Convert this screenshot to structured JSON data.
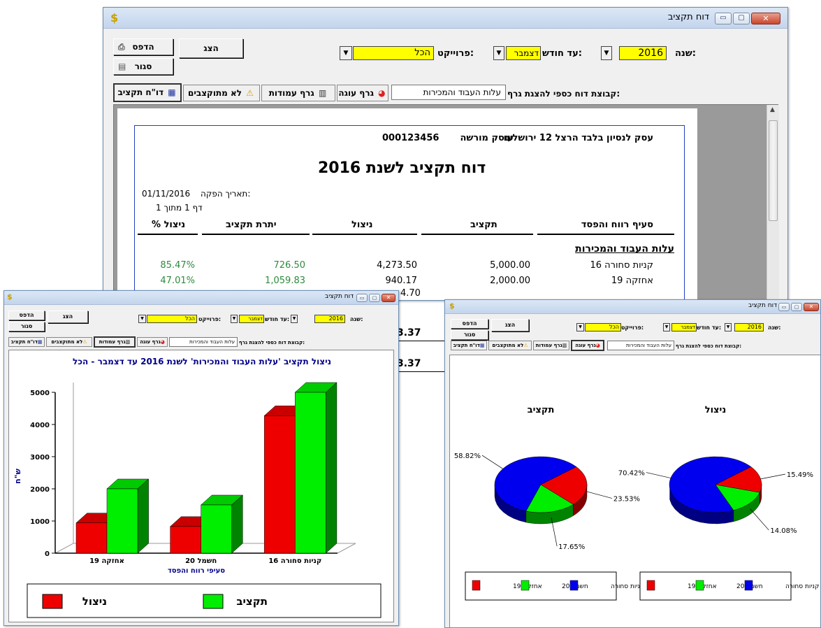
{
  "main_window": {
    "title": "דוח תקציב",
    "app_icon": "$",
    "toolbar": {
      "show_label": "הצג",
      "print_label": "הדפס",
      "close_label": "סגור"
    },
    "filters": {
      "year_label": "שנה:",
      "year_value": "2016",
      "month_label": "עד חודש:",
      "month_value": "דצמבר",
      "project_label": "פרוייקט:",
      "project_value": "הכל"
    },
    "graph_group_label": "קבוצת דוח כספי להצגת גרף:",
    "graph_group_value": "עלות העבוד והמכירות",
    "tabs": [
      {
        "label": "דו\"ח תקציב",
        "icon": "table-icon"
      },
      {
        "label": "לא מתוקצבים",
        "icon": "warning-icon"
      },
      {
        "label": "גרף עמודות",
        "icon": "bar-chart-icon"
      },
      {
        "label": "גרף עוגה",
        "icon": "pie-chart-icon"
      }
    ],
    "report": {
      "business_name": "עסק לנסיון בלבד הרצל 12 ירושלים",
      "business_id_label": "עוסק מורשה",
      "business_id": "000123456",
      "title": "דוח תקציב  לשנת 2016",
      "issue_date_label": "תאריך הפקה:",
      "issue_date": "01/11/2016",
      "page_label": "דף 1 מתוך 1",
      "columns": [
        "סעיף רווח והפסד",
        "תקציב",
        "ניצול",
        "יתרת תקציב",
        "% ניצול"
      ],
      "section_title": "עלות העבוד והמכירות",
      "rows": [
        {
          "item": "קניות סחורה 16",
          "budget": "5,000.00",
          "used": "4,273.50",
          "remaining": "726.50",
          "pct": "85.47%"
        },
        {
          "item": "אחזקה  19",
          "budget": "2,000.00",
          "used": "940.17",
          "remaining": "1,059.83",
          "pct": "47.01%"
        }
      ],
      "partial_values": [
        "4.70",
        "3.37",
        "3.37"
      ]
    }
  },
  "bar_window": {
    "title": "דוח תקציב",
    "toolbar": {
      "show_label": "הצג",
      "print_label": "הדפס",
      "close_label": "סגור"
    },
    "filters": {
      "year_label": "שנה:",
      "year_value": "2016",
      "month_label": "עד חודש:",
      "month_value": "דצמבר",
      "project_label": "פרוייקט:",
      "project_value": "הכל"
    },
    "graph_group_label": "קבוצת דוח כספי להצגת גרף:",
    "graph_group_value": "עלות העבוד והמכירות",
    "tabs": [
      "דו\"ח תקציב",
      "לא מתוקצבים",
      "גרף עמודות",
      "גרף עוגה"
    ]
  },
  "pie_window": {
    "title": "דוח תקציב",
    "toolbar": {
      "show_label": "הצג",
      "print_label": "הדפס",
      "close_label": "סגור"
    },
    "filters": {
      "year_label": "שנה:",
      "year_value": "2016",
      "month_label": "עד חודש:",
      "month_value": "דצמבר",
      "project_label": "פרוייקט:",
      "project_value": "הכל"
    },
    "graph_group_label": "קבוצת דוח כספי להצגת גרף:",
    "graph_group_value": "עלות העבוד והמכירות",
    "tabs": [
      "דו\"ח תקציב",
      "לא מתוקצבים",
      "גרף עמודות",
      "גרף עוגה"
    ]
  },
  "colors": {
    "budget": "#00ee00",
    "used": "#ee0000",
    "blue": "#0000ee",
    "title_blue": "#00008b",
    "field_yellow": "#ffff00"
  },
  "chart_data": [
    {
      "type": "bar",
      "title": "ניצול תקציב 'עלות העבוד והמכירות' לשנת 2016 עד דצמבר - הכל",
      "xlabel": "סעיפי רווח והפסד",
      "ylabel": "ש\"ח",
      "categories": [
        "אחזקה 19",
        "חשמל 20",
        "קניות סחורה 16"
      ],
      "series": [
        {
          "name": "ניצול",
          "values": [
            940,
            830,
            4273.5
          ]
        },
        {
          "name": "תקציב",
          "values": [
            2000,
            1500,
            5000
          ]
        }
      ],
      "yticks": [
        "0",
        "1000",
        "2000",
        "3000",
        "4000",
        "5000"
      ],
      "ylim": [
        0,
        5000
      ],
      "legend": "bottom"
    },
    {
      "type": "pie",
      "title": "תקציב",
      "labels": [
        "קניות סחורה",
        "חשמל 20",
        "אחזקה 19"
      ],
      "values": [
        58.82,
        17.65,
        23.53
      ],
      "value_labels": [
        "58.82%",
        "17.65%",
        "23.53%"
      ]
    },
    {
      "type": "pie",
      "title": "ניצול",
      "labels": [
        "קניות סחורה",
        "חשמל 20",
        "אחזקה 19"
      ],
      "values": [
        70.42,
        14.08,
        15.49
      ],
      "value_labels": [
        "70.42%",
        "14.08%",
        "15.49%"
      ]
    }
  ]
}
